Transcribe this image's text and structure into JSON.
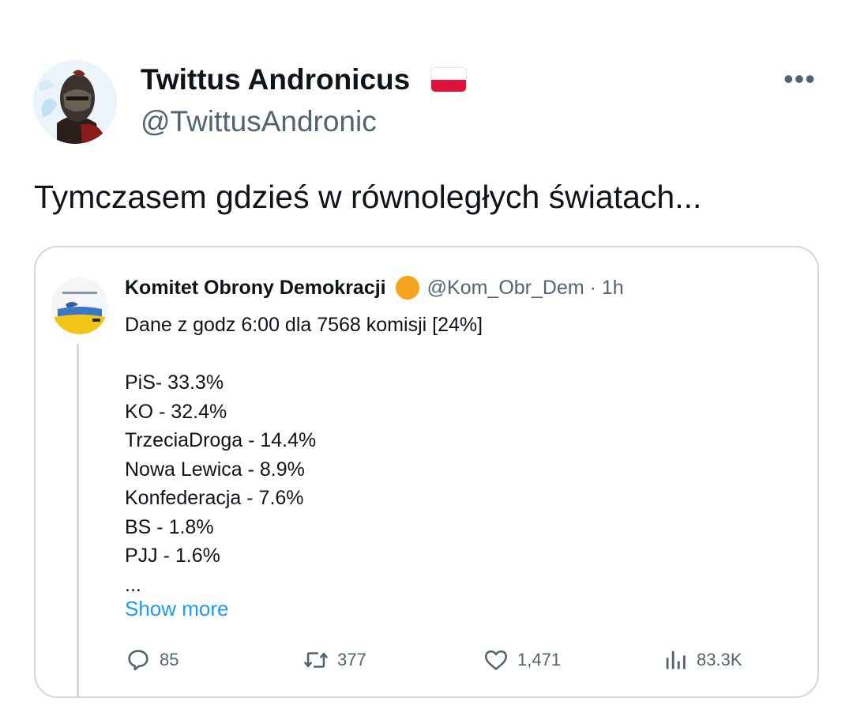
{
  "author": {
    "name": "Twittus Andronicus",
    "handle": "@TwittusAndronic",
    "flag_emoji": "poland-flag-icon"
  },
  "more_icon": "more-horizontal-icon",
  "tweet_text": "Tymczasem gdzieś w równoległych światach...",
  "quoted": {
    "name": "Komitet Obrony Demokracji",
    "badge_color": "#f5a21c",
    "handle_time": "@Kom_Obr_Dem · 1h",
    "lines": [
      "Dane z godz 6:00 dla 7568 komisji [24%]",
      "",
      "PiS- 33.3%",
      "KO - 32.4%",
      "TrzeciaDroga - 14.4%",
      "Nowa Lewica - 8.9%",
      "Konfederacja - 7.6%",
      "BS - 1.8%",
      "PJJ - 1.6%",
      "..."
    ],
    "show_more": "Show more",
    "stats": {
      "replies": "85",
      "retweets": "377",
      "likes": "1,471",
      "views": "83.3K"
    }
  },
  "colors": {
    "text": "#0f1419",
    "secondary": "#536471",
    "link": "#1d9bf0",
    "border": "#cfd9de"
  }
}
